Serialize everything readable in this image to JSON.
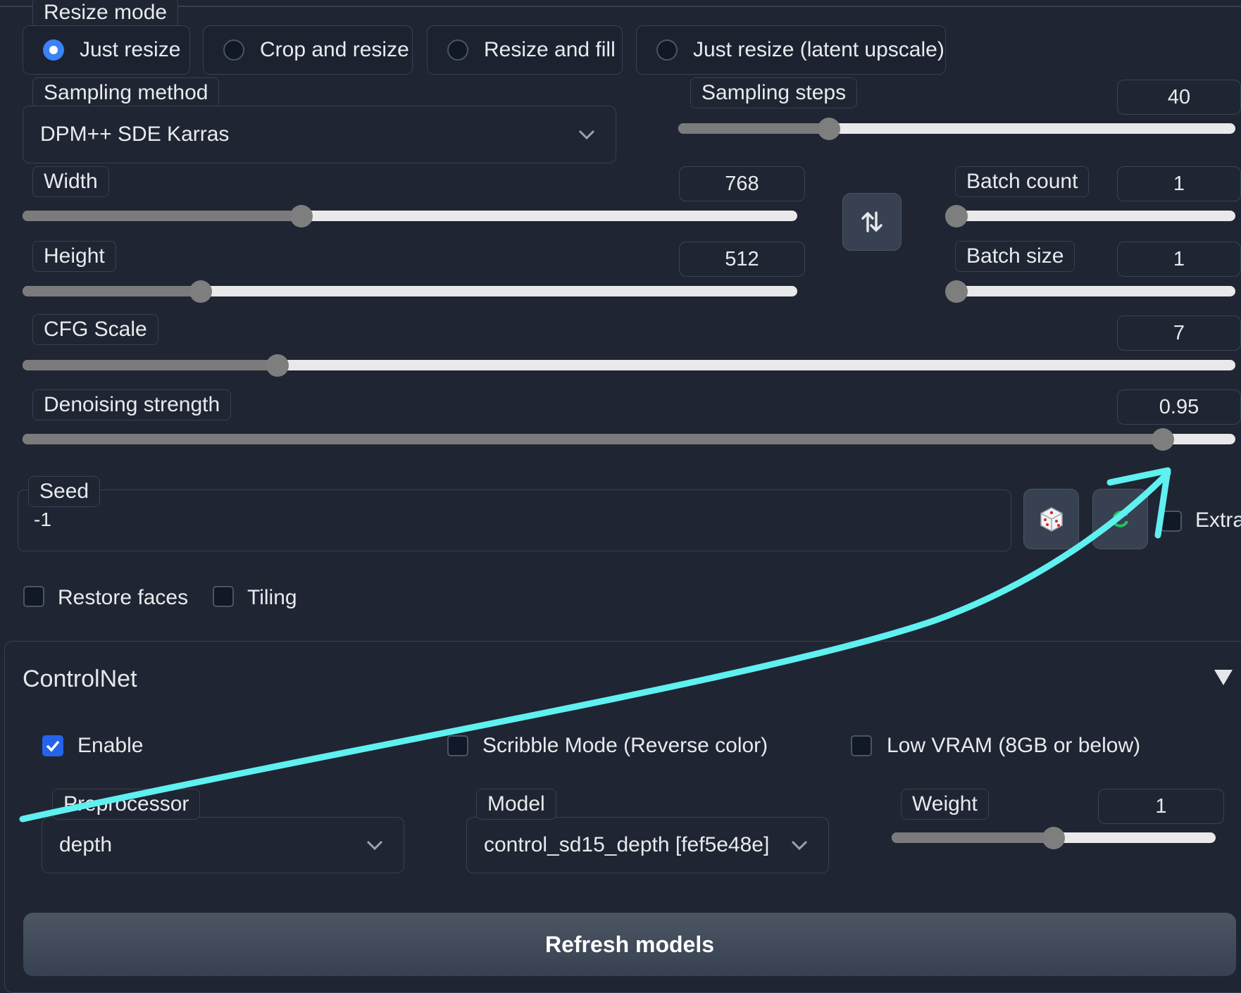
{
  "resize_mode": {
    "label": "Resize mode",
    "options": [
      {
        "label": "Just resize",
        "selected": true
      },
      {
        "label": "Crop and resize",
        "selected": false
      },
      {
        "label": "Resize and fill",
        "selected": false
      },
      {
        "label": "Just resize (latent upscale)",
        "selected": false
      }
    ]
  },
  "sampling_method": {
    "label": "Sampling method",
    "value": "DPM++ SDE Karras"
  },
  "sampling_steps": {
    "label": "Sampling steps",
    "value": "40",
    "fraction": 0.27
  },
  "width": {
    "label": "Width",
    "value": "768",
    "fraction": 0.36
  },
  "height": {
    "label": "Height",
    "value": "512",
    "fraction": 0.23
  },
  "swap_icon": "swap-vertical-icon",
  "batch_count": {
    "label": "Batch count",
    "value": "1",
    "fraction": 0.0
  },
  "batch_size": {
    "label": "Batch size",
    "value": "1",
    "fraction": 0.0
  },
  "cfg_scale": {
    "label": "CFG Scale",
    "value": "7",
    "fraction": 0.21
  },
  "denoising_strength": {
    "label": "Denoising strength",
    "value": "0.95",
    "fraction": 0.94
  },
  "seed": {
    "label": "Seed",
    "value": "-1",
    "extra_label": "Extra"
  },
  "checkboxes": [
    {
      "label": "Restore faces",
      "checked": false
    },
    {
      "label": "Tiling",
      "checked": false
    }
  ],
  "controlnet": {
    "title": "ControlNet",
    "enable": {
      "label": "Enable",
      "checked": true
    },
    "scribble": {
      "label": "Scribble Mode (Reverse color)",
      "checked": false
    },
    "lowvram": {
      "label": "Low VRAM (8GB or below)",
      "checked": false
    },
    "preprocessor": {
      "label": "Preprocessor",
      "value": "depth"
    },
    "model": {
      "label": "Model",
      "value": "control_sd15_depth [fef5e48e]"
    },
    "weight": {
      "label": "Weight",
      "value": "1",
      "fraction": 0.5
    },
    "refresh_label": "Refresh models"
  },
  "colors": {
    "background": "#1f2532",
    "accent": "#3b82f6",
    "annotation": "#5ff0f0"
  }
}
